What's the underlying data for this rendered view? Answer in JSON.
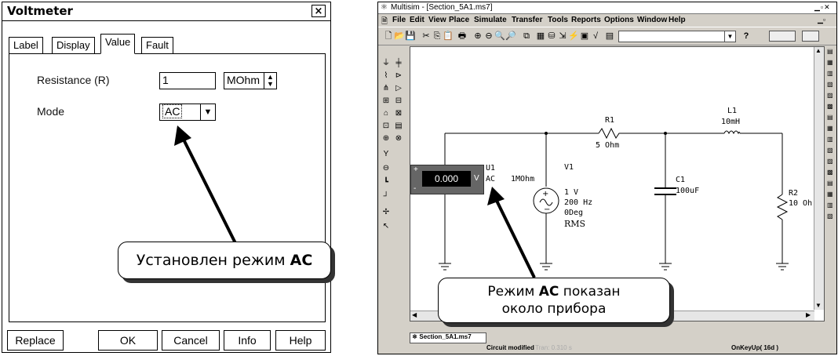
{
  "dialog": {
    "title": "Voltmeter",
    "close_glyph": "×",
    "tabs": [
      "Label",
      "Display",
      "Value",
      "Fault"
    ],
    "active_tab": "Value",
    "fields": {
      "resistance_label": "Resistance (R)",
      "resistance_value": "1",
      "resistance_unit": "MOhm",
      "mode_label": "Mode",
      "mode_value": "AC"
    },
    "buttons": {
      "replace": "Replace",
      "ok": "OK",
      "cancel": "Cancel",
      "info": "Info",
      "help": "Help"
    },
    "callout": {
      "text": "Установлен режим ",
      "bold": "AC"
    }
  },
  "app": {
    "title": "Multisim - [Section_5A1.ms7]",
    "menu": [
      "File",
      "Edit",
      "View",
      "Place",
      "Simulate",
      "Transfer",
      "Tools",
      "Reports",
      "Options",
      "Window",
      "Help"
    ],
    "help_glyph": "?",
    "circuit": {
      "voltmeter_reading": "0.000",
      "voltmeter_unit": "V",
      "voltmeter_ref": "U1",
      "voltmeter_mode": "AC",
      "voltmeter_res": "1MOhm",
      "source_ref": "V1",
      "source_lines": [
        "1 V",
        "200 Hz",
        "0Deg"
      ],
      "source_rms": "RMS",
      "r1_ref": "R1",
      "r1_val": "5 Ohm",
      "l1_ref": "L1",
      "l1_val": "10mH",
      "c1_ref": "C1",
      "c1_val": "100uF",
      "r2_ref": "R2",
      "r2_val": "10 Oh"
    },
    "tab_name": "Section_5A1.ms7",
    "status": {
      "modified": "Circuit modified",
      "tran": "Tran: 0.310 s",
      "onkey": "OnKeyUp( 16d )"
    },
    "callout": {
      "line1_prefix": "Режим ",
      "line1_bold": "AC",
      "line1_suffix": " показан",
      "line2": "около прибора"
    }
  }
}
